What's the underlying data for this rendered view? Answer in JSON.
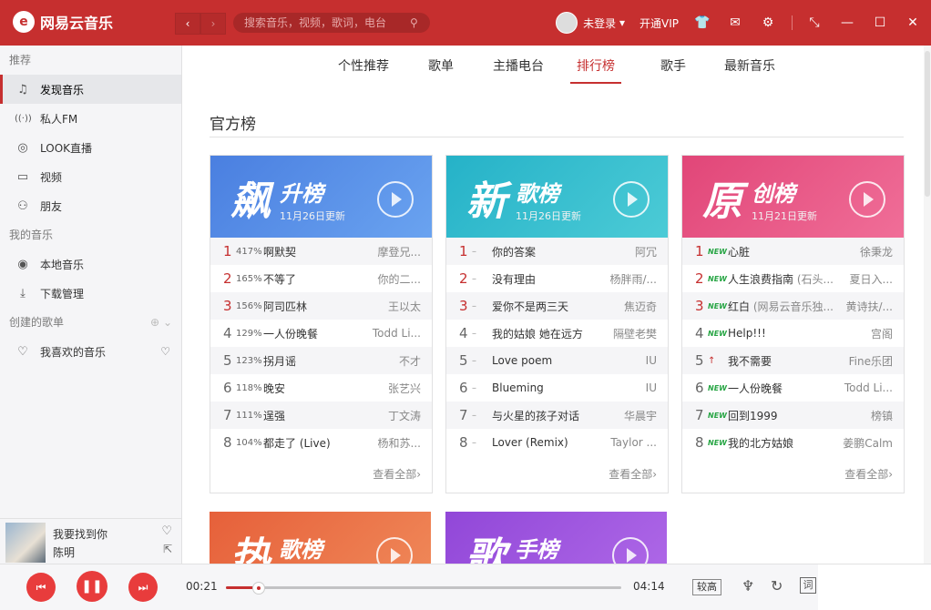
{
  "app": {
    "title": "网易云音乐",
    "logo_glyph": "e"
  },
  "toolbar": {
    "back": "‹",
    "forward": "›",
    "search_placeholder": "搜索音乐，视频，歌词，电台",
    "login": "未登录",
    "vip": "开通VIP"
  },
  "sidebar": {
    "group_recommend": "推荐",
    "items": [
      {
        "label": "发现音乐",
        "icon": "♫"
      },
      {
        "label": "私人FM",
        "icon": "((·))"
      },
      {
        "label": "LOOK直播",
        "icon": "◎"
      },
      {
        "label": "视频",
        "icon": "▭"
      },
      {
        "label": "朋友",
        "icon": "⚇"
      }
    ],
    "group_my_music": "我的音乐",
    "my_items": [
      {
        "label": "本地音乐",
        "icon": "◉"
      },
      {
        "label": "下载管理",
        "icon": "⤓"
      }
    ],
    "group_playlists": "创建的歌单",
    "playlists": [
      {
        "label": "我喜欢的音乐",
        "icon": "♡"
      }
    ]
  },
  "now_playing": {
    "title": "我要找到你",
    "artist": "陈明"
  },
  "tabs": [
    "个性推荐",
    "歌单",
    "主播电台",
    "排行榜",
    "歌手",
    "最新音乐"
  ],
  "active_tab": "排行榜",
  "section_title": "官方榜",
  "charts": [
    {
      "big": "飙",
      "title": "升榜",
      "date": "11月26日更新",
      "color_a": "#4a7fe0",
      "color_b": "#6aa3f0",
      "rows": [
        {
          "rank": "1",
          "chg": "417%",
          "song": "啊默契",
          "artist": "摩登兄..."
        },
        {
          "rank": "2",
          "chg": "165%",
          "song": "不等了",
          "artist": "你的二..."
        },
        {
          "rank": "3",
          "chg": "156%",
          "song": "阿司匹林",
          "artist": "王以太"
        },
        {
          "rank": "4",
          "chg": "129%",
          "song": "一人份晚餐",
          "artist": "Todd Li..."
        },
        {
          "rank": "5",
          "chg": "123%",
          "song": "拐月谣",
          "artist": "不才"
        },
        {
          "rank": "6",
          "chg": "118%",
          "song": "晚安",
          "artist": "张艺兴"
        },
        {
          "rank": "7",
          "chg": "111%",
          "song": "逞强",
          "artist": "丁文涛"
        },
        {
          "rank": "8",
          "chg": "104%",
          "song": "都走了 (Live)",
          "artist": "杨和苏..."
        }
      ],
      "view_all": "查看全部›"
    },
    {
      "big": "新",
      "title": "歌榜",
      "date": "11月26日更新",
      "color_a": "#25b2c8",
      "color_b": "#4ccbd6",
      "rows": [
        {
          "rank": "1",
          "chg": "–",
          "song": "你的答案",
          "artist": "阿冗"
        },
        {
          "rank": "2",
          "chg": "–",
          "song": "没有理由",
          "artist": "杨胖雨/..."
        },
        {
          "rank": "3",
          "chg": "–",
          "song": "爱你不是两三天",
          "artist": "焦迈奇"
        },
        {
          "rank": "4",
          "chg": "–",
          "song": "我的姑娘 她在远方",
          "artist": "隔壁老樊"
        },
        {
          "rank": "5",
          "chg": "–",
          "song": "Love poem",
          "artist": "IU"
        },
        {
          "rank": "6",
          "chg": "–",
          "song": "Blueming",
          "artist": "IU"
        },
        {
          "rank": "7",
          "chg": "–",
          "song": "与火星的孩子对话",
          "artist": "华晨宇"
        },
        {
          "rank": "8",
          "chg": "–",
          "song": "Lover (Remix)",
          "artist": "Taylor ..."
        }
      ],
      "view_all": "查看全部›"
    },
    {
      "big": "原",
      "title": "创榜",
      "date": "11月21日更新",
      "color_a": "#e14678",
      "color_b": "#f06e98",
      "rows": [
        {
          "rank": "1",
          "chg": "NEW",
          "song": "心脏",
          "artist": "徐秉龙"
        },
        {
          "rank": "2",
          "chg": "NEW",
          "song": "人生浪费指南 ",
          "muted": "(石头...",
          "artist": "夏日入..."
        },
        {
          "rank": "3",
          "chg": "NEW",
          "song": "红白 ",
          "muted": "(网易云音乐独...",
          "artist": "黄诗扶/..."
        },
        {
          "rank": "4",
          "chg": "NEW",
          "song": "Help!!!",
          "artist": "宫阁"
        },
        {
          "rank": "5",
          "chg": "↑",
          "song": "我不需要",
          "artist": "Fine乐团"
        },
        {
          "rank": "6",
          "chg": "NEW",
          "song": "一人份晚餐",
          "artist": "Todd Li..."
        },
        {
          "rank": "7",
          "chg": "NEW",
          "song": "回到1999",
          "artist": "榜镇"
        },
        {
          "rank": "8",
          "chg": "NEW",
          "song": "我的北方姑娘",
          "artist": "姜鹏Calm"
        }
      ],
      "view_all": "查看全部›"
    }
  ],
  "more_charts": [
    {
      "big": "热",
      "title": "歌榜",
      "color_a": "#e6603a",
      "color_b": "#f08a5a"
    },
    {
      "big": "歌",
      "title": "手榜",
      "color_a": "#9147d8",
      "color_b": "#b06ae8"
    }
  ],
  "player": {
    "elapsed": "00:21",
    "total": "04:14",
    "progress": 0.08,
    "quality": "较高",
    "lyric": "词",
    "prev": "⏮",
    "pause": "❚❚",
    "next": "⏭"
  },
  "colors": {
    "brand": "#c62f2f"
  }
}
